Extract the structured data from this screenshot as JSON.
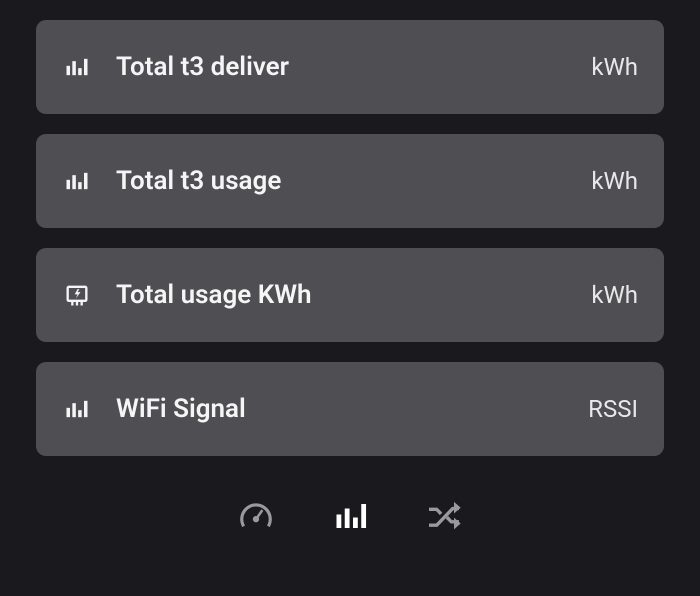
{
  "sensors": [
    {
      "label": "Total t3 deliver",
      "unit": "kWh",
      "icon": "bars"
    },
    {
      "label": "Total t3 usage",
      "unit": "kWh",
      "icon": "bars"
    },
    {
      "label": "Total usage KWh",
      "unit": "kWh",
      "icon": "meter"
    },
    {
      "label": "WiFi Signal",
      "unit": "RSSI",
      "icon": "bars"
    }
  ],
  "nav": {
    "gauge_label": "gauge",
    "bars_label": "statistics",
    "shuffle_label": "shuffle"
  }
}
